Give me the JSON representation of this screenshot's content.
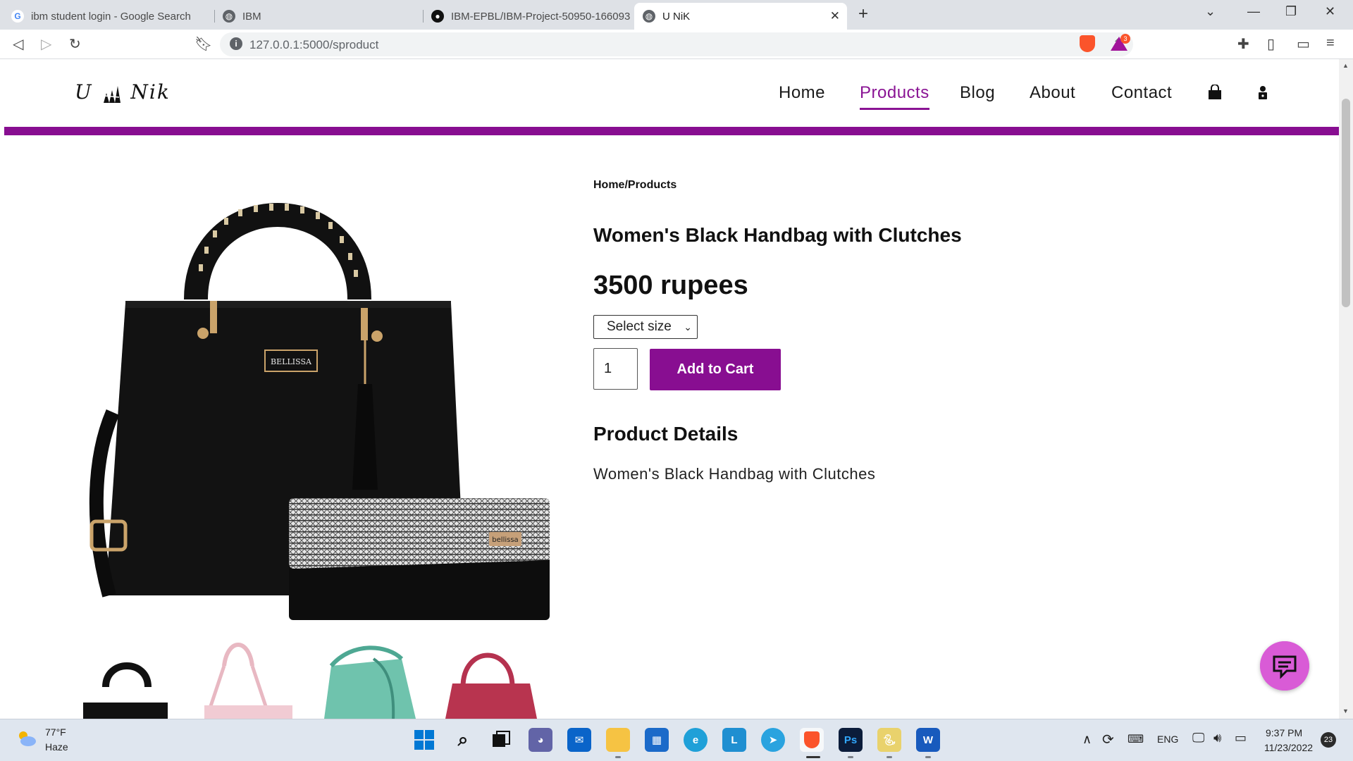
{
  "browser": {
    "tabs": [
      {
        "title": "ibm student login - Google Search",
        "icon": "google-icon"
      },
      {
        "title": "IBM",
        "icon": "globe-icon"
      },
      {
        "title": "IBM-EPBL/IBM-Project-50950-166093",
        "icon": "github-icon"
      },
      {
        "title": "U NiK",
        "icon": "globe-icon",
        "active": true
      }
    ],
    "url": "127.0.0.1:5000/sproduct",
    "rewards_count": "3"
  },
  "site": {
    "logo": {
      "left": "U",
      "right": "Nik"
    },
    "nav": [
      {
        "label": "Home"
      },
      {
        "label": "Products",
        "active": true
      },
      {
        "label": "Blog"
      },
      {
        "label": "About"
      },
      {
        "label": "Contact"
      }
    ],
    "accent_color": "#880e91",
    "icons": [
      "shopping-bag-icon",
      "user-lock-icon"
    ]
  },
  "product": {
    "breadcrumb": "Home/Products",
    "title": "Women's Black Handbag with Clutches",
    "price": "3500 rupees",
    "size_select": "Select size",
    "quantity": "1",
    "add_to_cart": "Add to Cart",
    "details_heading": "Product Details",
    "details_text": "Women's Black Handbag with Clutches",
    "image_brand": "BELLISSA",
    "clutch_brand": "bellissa",
    "thumbnails": [
      "black-handbag",
      "pink-handbag",
      "teal-handbag",
      "maroon-handbag"
    ]
  },
  "taskbar": {
    "weather_temp": "77°F",
    "weather_cond": "Haze",
    "lang": "ENG",
    "time": "9:37 PM",
    "date": "11/23/2022",
    "notifications": "23"
  }
}
